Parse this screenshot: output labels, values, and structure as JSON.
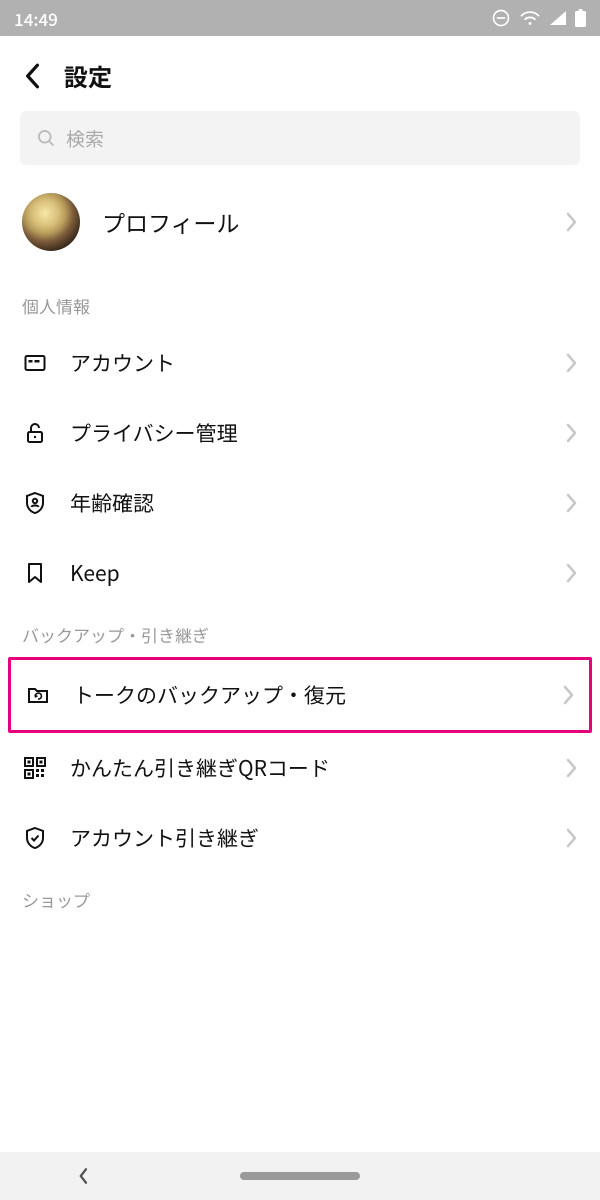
{
  "statusbar": {
    "time": "14:49"
  },
  "header": {
    "title": "設定"
  },
  "search": {
    "placeholder": "検索"
  },
  "profile": {
    "label": "プロフィール"
  },
  "sections": {
    "personal": {
      "title": "個人情報",
      "items": [
        {
          "label": "アカウント"
        },
        {
          "label": "プライバシー管理"
        },
        {
          "label": "年齢確認"
        },
        {
          "label": "Keep"
        }
      ]
    },
    "backup": {
      "title": "バックアップ・引き継ぎ",
      "items": [
        {
          "label": "トークのバックアップ・復元"
        },
        {
          "label": "かんたん引き継ぎQRコード"
        },
        {
          "label": "アカウント引き継ぎ"
        }
      ]
    },
    "shop": {
      "title": "ショップ"
    }
  },
  "colors": {
    "highlight": "#e6007e"
  }
}
